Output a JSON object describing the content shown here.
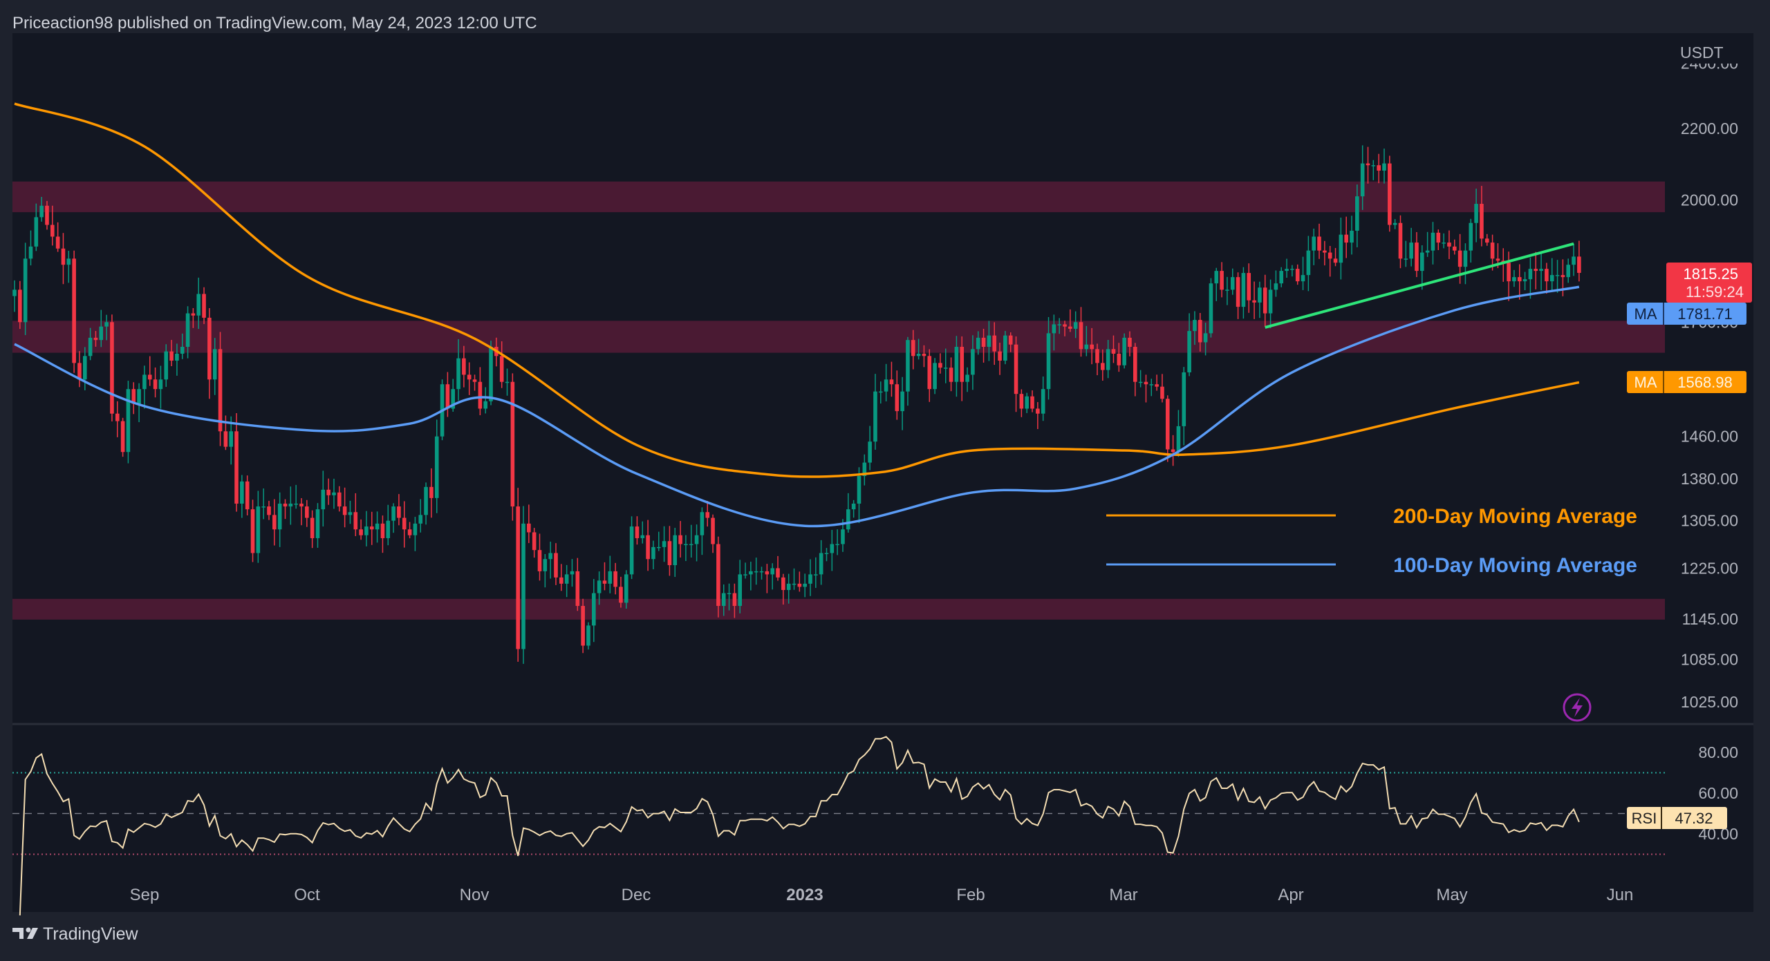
{
  "header": {
    "attribution": "Priceaction98 published on TradingView.com, May 24, 2023 12:00 UTC"
  },
  "footer": {
    "brand": "TradingView",
    "logo_icon": "tradingview-logo-icon"
  },
  "price_axis": {
    "currency": "USDT",
    "ticks": [
      "2400.00",
      "2200.00",
      "2000.00",
      "1700.00",
      "1460.00",
      "1380.00",
      "1305.00",
      "1225.00",
      "1145.00",
      "1085.00",
      "1025.00"
    ]
  },
  "price_labels": {
    "last": {
      "price": "1815.25",
      "countdown": "11:59:24",
      "color": "#f23645"
    },
    "ma100": {
      "tag": "MA",
      "value": "1781.71",
      "color": "#5b9cf6"
    },
    "ma200": {
      "tag": "MA",
      "value": "1568.98",
      "color": "#ff9800"
    }
  },
  "rsi": {
    "tag": "RSI",
    "value": "47.32",
    "ticks": [
      "80.00",
      "60.00",
      "40.00"
    ],
    "upper_band": 70,
    "lower_band": 30,
    "mid": 50,
    "line_color": "#f5deb3"
  },
  "time_axis": [
    "Sep",
    "Oct",
    "Nov",
    "Dec",
    "2023",
    "Feb",
    "Mar",
    "Apr",
    "May",
    "Jun"
  ],
  "legend": [
    {
      "label": "200-Day Moving Average",
      "color": "#ff9800"
    },
    {
      "label": "100-Day Moving Average",
      "color": "#5b9cf6"
    }
  ],
  "icons": {
    "alert": "lightning-icon"
  },
  "chart_data": {
    "type": "candlestick",
    "symbol_currency": "USDT",
    "scale": "log",
    "start_date": "2022-08-08",
    "interval": "1D",
    "up_color": "#089981",
    "down_color": "#f23645",
    "closes": [
      1775,
      1700,
      1850,
      1880,
      1955,
      1985,
      1935,
      1905,
      1875,
      1835,
      1850,
      1610,
      1575,
      1625,
      1665,
      1660,
      1690,
      1700,
      1505,
      1490,
      1430,
      1555,
      1525,
      1555,
      1585,
      1575,
      1555,
      1575,
      1635,
      1615,
      1630,
      1645,
      1720,
      1715,
      1765,
      1710,
      1575,
      1640,
      1470,
      1440,
      1470,
      1335,
      1375,
      1325,
      1250,
      1330,
      1330,
      1315,
      1290,
      1335,
      1330,
      1335,
      1335,
      1330,
      1310,
      1275,
      1325,
      1360,
      1350,
      1355,
      1330,
      1315,
      1320,
      1290,
      1280,
      1295,
      1290,
      1300,
      1275,
      1305,
      1330,
      1310,
      1290,
      1280,
      1300,
      1315,
      1365,
      1345,
      1460,
      1565,
      1515,
      1555,
      1620,
      1585,
      1575,
      1570,
      1515,
      1530,
      1645,
      1625,
      1570,
      1570,
      1330,
      1100,
      1300,
      1285,
      1255,
      1220,
      1240,
      1250,
      1210,
      1200,
      1215,
      1220,
      1165,
      1105,
      1135,
      1185,
      1205,
      1200,
      1220,
      1195,
      1170,
      1215,
      1295,
      1275,
      1280,
      1240,
      1260,
      1260,
      1270,
      1230,
      1280,
      1265,
      1265,
      1265,
      1280,
      1320,
      1310,
      1265,
      1165,
      1185,
      1185,
      1165,
      1215,
      1215,
      1220,
      1220,
      1220,
      1215,
      1225,
      1210,
      1190,
      1200,
      1200,
      1195,
      1200,
      1215,
      1215,
      1250,
      1250,
      1265,
      1265,
      1290,
      1325,
      1335,
      1385,
      1410,
      1450,
      1550,
      1550,
      1575,
      1565,
      1510,
      1550,
      1660,
      1625,
      1630,
      1625,
      1555,
      1610,
      1600,
      1600,
      1570,
      1645,
      1570,
      1585,
      1640,
      1665,
      1645,
      1670,
      1635,
      1615,
      1670,
      1650,
      1545,
      1515,
      1540,
      1515,
      1505,
      1555,
      1675,
      1695,
      1695,
      1690,
      1685,
      1700,
      1640,
      1650,
      1640,
      1610,
      1595,
      1640,
      1630,
      1605,
      1665,
      1645,
      1570,
      1570,
      1565,
      1565,
      1560,
      1535,
      1435,
      1430,
      1480,
      1590,
      1680,
      1705,
      1655,
      1675,
      1790,
      1820,
      1775,
      1775,
      1805,
      1735,
      1815,
      1750,
      1745,
      1780,
      1720,
      1775,
      1790,
      1820,
      1825,
      1825,
      1795,
      1810,
      1870,
      1905,
      1870,
      1865,
      1850,
      1840,
      1910,
      1890,
      1920,
      2010,
      2100,
      2095,
      2095,
      2080,
      2100,
      1935,
      1940,
      1850,
      1850,
      1890,
      1820,
      1865,
      1870,
      1915,
      1890,
      1890,
      1880,
      1870,
      1830,
      1870,
      1940,
      1990,
      1900,
      1890,
      1850,
      1845,
      1840,
      1795,
      1805,
      1795,
      1800,
      1825,
      1820,
      1825,
      1795,
      1810,
      1810,
      1805,
      1835,
      1855,
      1815.25
    ],
    "ma200": [
      [
        "2022-08-08",
        2274
      ],
      [
        "2022-09-01",
        2148
      ],
      [
        "2022-10-01",
        1807
      ],
      [
        "2022-11-01",
        1663
      ],
      [
        "2022-12-01",
        1443
      ],
      [
        "2022-12-25",
        1388
      ],
      [
        "2023-01-15",
        1392
      ],
      [
        "2023-02-01",
        1433
      ],
      [
        "2023-03-01",
        1433
      ],
      [
        "2023-03-12",
        1425
      ],
      [
        "2023-04-01",
        1443
      ],
      [
        "2023-05-01",
        1516
      ],
      [
        "2023-05-24",
        1568.98
      ]
    ],
    "ma100": [
      [
        "2022-08-08",
        1651
      ],
      [
        "2022-09-01",
        1520
      ],
      [
        "2022-10-01",
        1472
      ],
      [
        "2022-10-20",
        1485
      ],
      [
        "2022-11-05",
        1535
      ],
      [
        "2022-12-01",
        1389
      ],
      [
        "2023-01-01",
        1296
      ],
      [
        "2023-02-01",
        1355
      ],
      [
        "2023-02-20",
        1362
      ],
      [
        "2023-03-10",
        1425
      ],
      [
        "2023-04-01",
        1590
      ],
      [
        "2023-05-01",
        1727
      ],
      [
        "2023-05-24",
        1781.71
      ]
    ],
    "zones": [
      {
        "from": 1968,
        "to": 2050
      },
      {
        "from": 1632,
        "to": 1703
      },
      {
        "from": 1144,
        "to": 1176
      }
    ],
    "zone_color": "#4a1a33",
    "trendline": {
      "from": [
        "2023-03-27",
        1688
      ],
      "to": [
        "2023-05-23",
        1887
      ],
      "color": "#2ee57a"
    }
  }
}
